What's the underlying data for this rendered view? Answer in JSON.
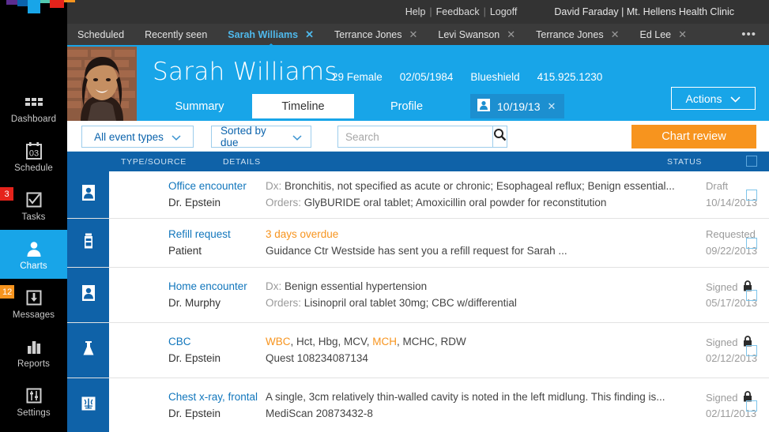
{
  "topbar": {
    "help": "Help",
    "feedback": "Feedback",
    "logoff": "Logoff",
    "sep": "|",
    "user": "David Faraday | Mt. Hellens Health Clinic"
  },
  "patient_tabs": [
    {
      "label": "Scheduled",
      "closable": false,
      "active": false
    },
    {
      "label": "Recently seen",
      "closable": false,
      "active": false
    },
    {
      "label": "Sarah Williams",
      "closable": true,
      "active": true
    },
    {
      "label": "Terrance Jones",
      "closable": true,
      "active": false
    },
    {
      "label": "Levi Swanson",
      "closable": true,
      "active": false
    },
    {
      "label": "Terrance Jones",
      "closable": true,
      "active": false
    },
    {
      "label": "Ed Lee",
      "closable": true,
      "active": false
    }
  ],
  "tab_overflow": "•••",
  "close_glyph": "✕",
  "sidebar": {
    "items": [
      {
        "label": "Dashboard",
        "icon": "grid-icon",
        "badge": null,
        "active": false
      },
      {
        "label": "Schedule",
        "icon": "calendar-icon",
        "badge": null,
        "active": false,
        "day": "03"
      },
      {
        "label": "Tasks",
        "icon": "checkbox-icon",
        "badge": "3",
        "badge_color": "#e5231b",
        "active": false
      },
      {
        "label": "Charts",
        "icon": "person-icon",
        "badge": null,
        "active": true
      },
      {
        "label": "Messages",
        "icon": "inbox-download-icon",
        "badge": "12",
        "badge_color": "#f7941e",
        "active": false
      },
      {
        "label": "Reports",
        "icon": "bar-chart-icon",
        "badge": null,
        "active": false
      },
      {
        "label": "Settings",
        "icon": "sliders-icon",
        "badge": null,
        "active": false
      }
    ]
  },
  "patient": {
    "name": "Sarah Williams",
    "age_sex": "29 Female",
    "dob": "02/05/1984",
    "insurance": "Blueshield",
    "phone": "415.925.1230",
    "subtabs": [
      {
        "label": "Summary",
        "active": false
      },
      {
        "label": "Timeline",
        "active": true
      },
      {
        "label": "Profile",
        "active": false
      }
    ],
    "date_chip": "10/19/13",
    "date_chip_close": "✕",
    "actions_label": "Actions",
    "actions_caret": "⌄"
  },
  "filters": {
    "event_types": "All event types",
    "sort": "Sorted  by due",
    "caret": "⌄",
    "search_placeholder": "Search",
    "search_value": "",
    "chart_review": "Chart review"
  },
  "table": {
    "headers": {
      "type_source": "TYPE/SOURCE",
      "details": "DETAILS",
      "status": "STATUS"
    },
    "rows": [
      {
        "icon": "person-icon",
        "type": "Office encounter",
        "source": "Dr. Epstein",
        "detail_label_1": "Dx:",
        "detail_1": "Bronchitis, not specified as acute or chronic; Esophageal reflux; Benign essential...",
        "detail_label_2": "Orders:",
        "detail_2": "GlyBURIDE oral tablet; Amoxicillin oral powder for reconstitution",
        "status": "Draft",
        "locked": false,
        "date": "10/14/2013"
      },
      {
        "icon": "pill-bottle-icon",
        "type": "Refill request",
        "source": "Patient",
        "detail_label_1": "",
        "detail_1": "3 days overdue",
        "detail_1_highlight": true,
        "detail_label_2": "",
        "detail_2": "Guidance Ctr Westside has sent you a refill request for Sarah ...",
        "status": "Requested",
        "locked": false,
        "date": "09/22/2013"
      },
      {
        "icon": "person-icon",
        "type": "Home encounter",
        "source": "Dr. Murphy",
        "detail_label_1": "Dx:",
        "detail_1": "Benign essential hypertension",
        "detail_label_2": "Orders:",
        "detail_2": "Lisinopril oral tablet 30mg; CBC w/differential",
        "status": "Signed",
        "locked": true,
        "date": "05/17/2013"
      },
      {
        "icon": "flask-icon",
        "type": "CBC",
        "source": "Dr. Epstein",
        "detail_label_1": "",
        "detail_1_parts": [
          {
            "text": "WBC",
            "highlight": true
          },
          {
            "text": ", Hct, Hbg, MCV, ",
            "highlight": false
          },
          {
            "text": "MCH",
            "highlight": true
          },
          {
            "text": ", MCHC, RDW",
            "highlight": false
          }
        ],
        "detail_label_2": "",
        "detail_2": "Quest 108234087134",
        "status": "Signed",
        "locked": true,
        "date": "02/12/2013"
      },
      {
        "icon": "xray-icon",
        "type": "Chest x-ray, frontal",
        "source": "Dr. Epstein",
        "detail_label_1": "",
        "detail_1": "A single, 3cm relatively thin-walled cavity is noted in the left midlung. This finding is...",
        "detail_label_2": "",
        "detail_2": "MediScan 20873432-8",
        "status": "Signed",
        "locked": true,
        "date": "02/11/2013"
      }
    ]
  },
  "colors": {
    "accent_blue": "#18a5e8",
    "header_blue": "#0f62a8",
    "orange": "#f7941e",
    "link_blue": "#1176bc",
    "sidebar_black": "#000000",
    "topbar_gray": "#333333"
  },
  "logo": {
    "blocks": [
      "#5b2d90",
      "#0b63ac",
      "#18a5e8",
      "#52c9b0",
      "#e5231b",
      "#f7941e"
    ]
  }
}
